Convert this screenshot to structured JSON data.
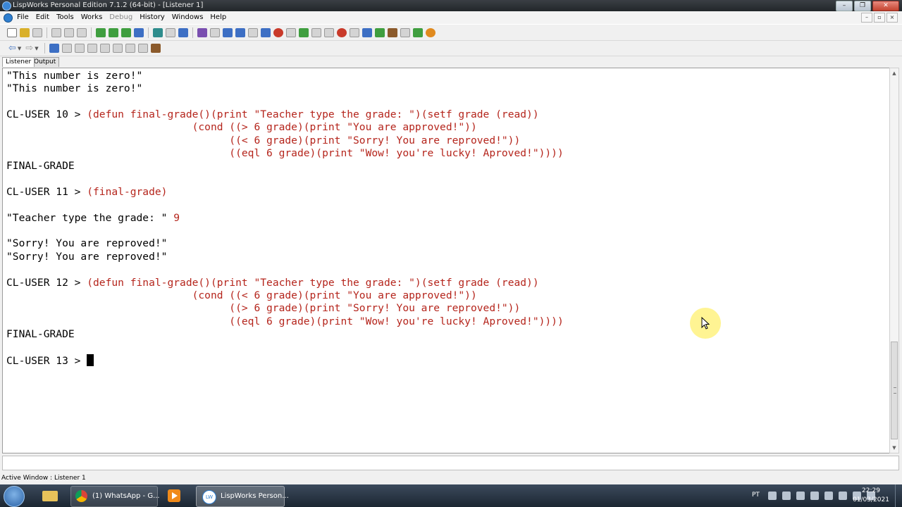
{
  "window": {
    "title": "LispWorks Personal Edition 7.1.2 (64-bit) - [Listener 1]",
    "controls": [
      "–",
      "❐",
      "✕"
    ]
  },
  "menubar": {
    "items": [
      {
        "label": "File",
        "enabled": true
      },
      {
        "label": "Edit",
        "enabled": true
      },
      {
        "label": "Tools",
        "enabled": true
      },
      {
        "label": "Works",
        "enabled": true
      },
      {
        "label": "Debug",
        "enabled": false
      },
      {
        "label": "History",
        "enabled": true
      },
      {
        "label": "Windows",
        "enabled": true
      },
      {
        "label": "Help",
        "enabled": true
      }
    ],
    "doc_controls": [
      "–",
      "▫",
      "×"
    ]
  },
  "tabs": [
    {
      "label": "Listener",
      "active": true
    },
    {
      "label": "Output",
      "active": false
    }
  ],
  "listener": {
    "lines": [
      {
        "kind": "out",
        "text": "\"This number is zero!\""
      },
      {
        "kind": "out",
        "text": "\"This number is zero!\""
      },
      {
        "kind": "blank",
        "text": ""
      },
      {
        "kind": "prompt",
        "prompt": "CL-USER 10 > ",
        "input": "(defun final-grade()(print \"Teacher type the grade: \")(setf grade (read))"
      },
      {
        "kind": "in",
        "text": "                              (cond ((> 6 grade)(print \"You are approved!\"))"
      },
      {
        "kind": "in",
        "text": "                                    ((< 6 grade)(print \"Sorry! You are reproved!\"))"
      },
      {
        "kind": "in",
        "text": "                                    ((eql 6 grade)(print \"Wow! you're lucky! Aproved!\"))))"
      },
      {
        "kind": "out",
        "text": "FINAL-GRADE"
      },
      {
        "kind": "blank",
        "text": ""
      },
      {
        "kind": "prompt",
        "prompt": "CL-USER 11 > ",
        "input": "(final-grade)"
      },
      {
        "kind": "blank",
        "text": ""
      },
      {
        "kind": "prompt",
        "prompt": "\"Teacher type the grade: \" ",
        "input": "9"
      },
      {
        "kind": "blank",
        "text": ""
      },
      {
        "kind": "out",
        "text": "\"Sorry! You are reproved!\""
      },
      {
        "kind": "out",
        "text": "\"Sorry! You are reproved!\""
      },
      {
        "kind": "blank",
        "text": ""
      },
      {
        "kind": "prompt",
        "prompt": "CL-USER 12 > ",
        "input": "(defun final-grade()(print \"Teacher type the grade: \")(setf grade (read))"
      },
      {
        "kind": "in",
        "text": "                              (cond ((< 6 grade)(print \"You are approved!\"))"
      },
      {
        "kind": "in",
        "text": "                                    ((> 6 grade)(print \"Sorry! You are reproved!\"))"
      },
      {
        "kind": "in",
        "text": "                                    ((eql 6 grade)(print \"Wow! you're lucky! Aproved!\"))))"
      },
      {
        "kind": "out",
        "text": "FINAL-GRADE"
      },
      {
        "kind": "blank",
        "text": ""
      },
      {
        "kind": "current",
        "prompt": "CL-USER 13 > ",
        "input": ""
      }
    ],
    "colors": {
      "output": "#000000",
      "input": "#b5251c"
    }
  },
  "status": {
    "text": "Active Window : Listener 1"
  },
  "taskbar": {
    "items": [
      {
        "name": "windows-explorer",
        "label": ""
      },
      {
        "name": "chrome",
        "label": "(1) WhatsApp - G..."
      },
      {
        "name": "media-player",
        "label": ""
      },
      {
        "name": "lispworks",
        "label": "LispWorks Person..."
      }
    ],
    "lispworks_icon_text": "LW",
    "tray": {
      "language": "PT",
      "time": "22:29",
      "date": "01/03/2021"
    }
  }
}
